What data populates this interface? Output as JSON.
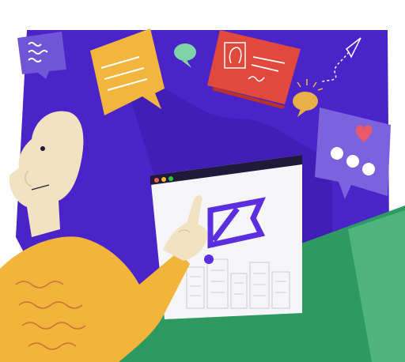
{
  "colors": {
    "background": "#ffffff",
    "purple_panel": "#4a23c9",
    "purple_shadow": "#3a1aa6",
    "card_lilac": "#6f56d6",
    "card_yellow": "#f2b63e",
    "card_red": "#e0493b",
    "chat_mint": "#7fd3a6",
    "chat_amber": "#e9b04a",
    "skin": "#f1e2c2",
    "sweater": "#f2b43a",
    "sweater_wave": "#c7743a",
    "green_shape": "#2e9a61",
    "green_light": "#5cbf86",
    "logo_purple": "#5b2ee0",
    "browser_white": "#f6f6f8",
    "browser_bar": "#1f1a3a",
    "dot_red": "#ff5f57",
    "dot_yellow": "#febc2e",
    "dot_green": "#28c840",
    "heart": "#e85a6a"
  },
  "icons": {
    "paper_plane": "paper-plane-icon",
    "heart": "heart-icon",
    "logo": "brand-logo-icon"
  }
}
